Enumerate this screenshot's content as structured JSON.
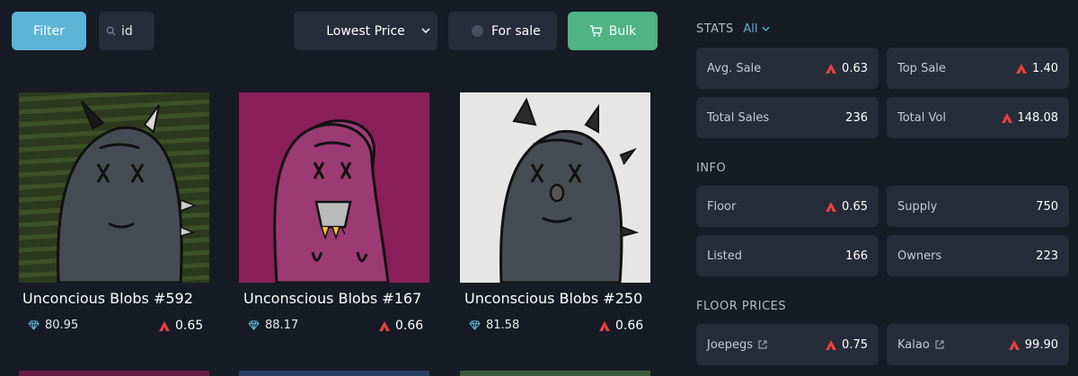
{
  "toolbar": {
    "filter_label": "Filter",
    "search_value": "id",
    "sort_label": "Lowest Price",
    "for_sale_label": "For sale",
    "bulk_label": "Bulk"
  },
  "cards": [
    {
      "title": "Unconcious Blobs #592",
      "rank": "80.95",
      "price": "0.65"
    },
    {
      "title": "Unconscious Blobs #167",
      "rank": "88.17",
      "price": "0.66"
    },
    {
      "title": "Unconscious Blobs #250",
      "rank": "81.58",
      "price": "0.66"
    }
  ],
  "stats": {
    "title": "STATS",
    "filter": "All",
    "avg_sale_label": "Avg. Sale",
    "avg_sale_value": "0.63",
    "top_sale_label": "Top Sale",
    "top_sale_value": "1.40",
    "total_sales_label": "Total Sales",
    "total_sales_value": "236",
    "total_vol_label": "Total Vol",
    "total_vol_value": "148.08"
  },
  "info": {
    "title": "INFO",
    "floor_label": "Floor",
    "floor_value": "0.65",
    "supply_label": "Supply",
    "supply_value": "750",
    "listed_label": "Listed",
    "listed_value": "166",
    "owners_label": "Owners",
    "owners_value": "223"
  },
  "floor_prices": {
    "title": "FLOOR PRICES",
    "joepegs_label": "Joepegs",
    "joepegs_value": "0.75",
    "kalao_label": "Kalao",
    "kalao_value": "99.90"
  },
  "colors": {
    "accent": "#5db5d6",
    "bulk_green": "#4fb383",
    "avax_red": "#e84142",
    "panel": "#262c3a",
    "background": "#161b26"
  },
  "icons": [
    "search-icon",
    "chevron-down-icon",
    "cart-icon",
    "diamond-icon",
    "avax-icon",
    "external-link-icon"
  ]
}
